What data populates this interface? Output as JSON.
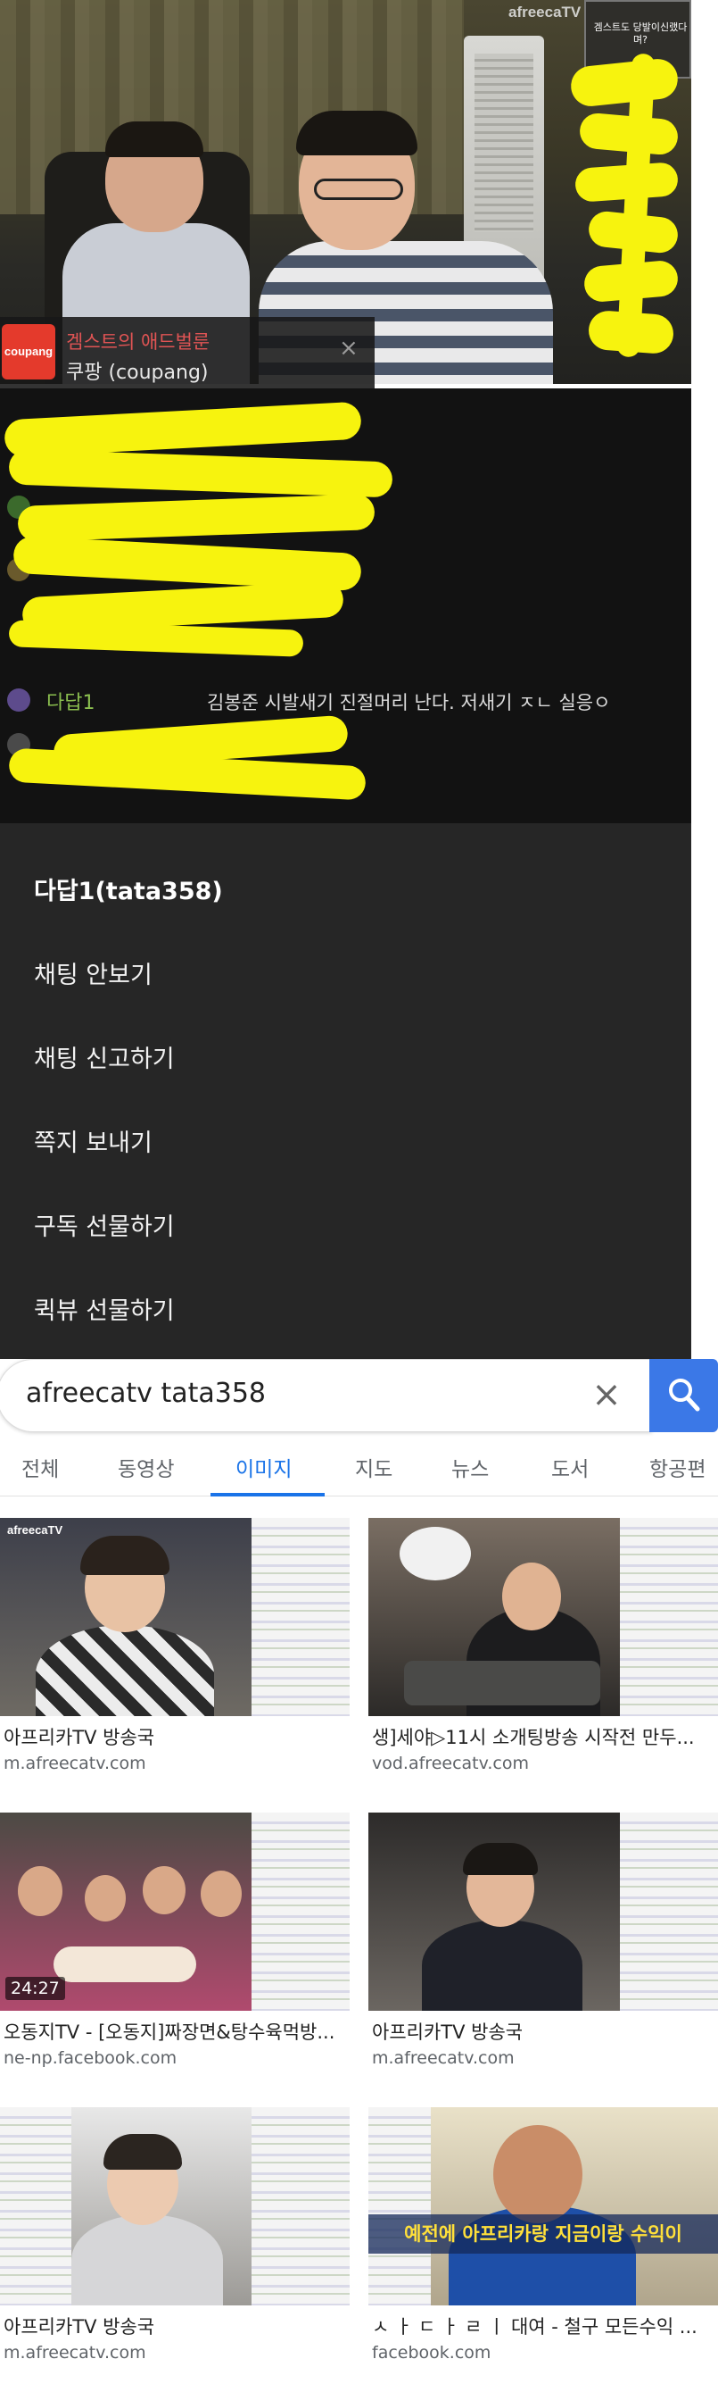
{
  "stream": {
    "watermark": "afreecaTV",
    "pip_caption": "겜스트도 당발이신랬다며?"
  },
  "ad": {
    "logo_text": "coupang",
    "title": "겜스트의 애드벌룬",
    "subtitle": "쿠팡 (coupang)",
    "close_icon": "×"
  },
  "chat": {
    "messages": [
      {
        "nick": "다답1",
        "text": "김봉준 시발새기 진절머리 난다. 저새기 ㅈㄴ 실응ㅇ"
      }
    ]
  },
  "context_menu": {
    "header": "다답1(tata358)",
    "items": [
      "채팅 안보기",
      "채팅 신고하기",
      "쪽지 보내기",
      "구독 선물하기",
      "퀵뷰 선물하기"
    ]
  },
  "search": {
    "query": "afreecatv tata358",
    "clear_icon": "×",
    "tabs": [
      "전체",
      "동영상",
      "이미지",
      "지도",
      "뉴스",
      "도서",
      "항공편"
    ],
    "active_tab": "이미지",
    "results": [
      {
        "title": "아프리카TV 방송국",
        "source": "m.afreecatv.com",
        "thumb_label": "afreecaTV"
      },
      {
        "title": "생]세야▷11시 소개팅방송 시작전 만두...",
        "source": "vod.afreecatv.com"
      },
      {
        "title": "오동지TV - [오동지]짜장면&탕수육먹방...",
        "source": "ne-np.facebook.com",
        "duration": "24:27"
      },
      {
        "title": "아프리카TV 방송국",
        "source": "m.afreecatv.com"
      },
      {
        "title": "아프리카TV 방송국",
        "source": "m.afreecatv.com"
      },
      {
        "title": "ㅅ ㅏ ㄷ ㅏ ㄹ ㅣ  대여 - 철구 모든수익 ...",
        "source": "facebook.com",
        "banner": "예전에 아프리카랑 지금이랑 수익이"
      }
    ]
  },
  "colors": {
    "scribble": "#f7f30e",
    "search_button": "#3b78e7",
    "active_tab": "#1a73e8",
    "menu_bg": "#262626"
  }
}
